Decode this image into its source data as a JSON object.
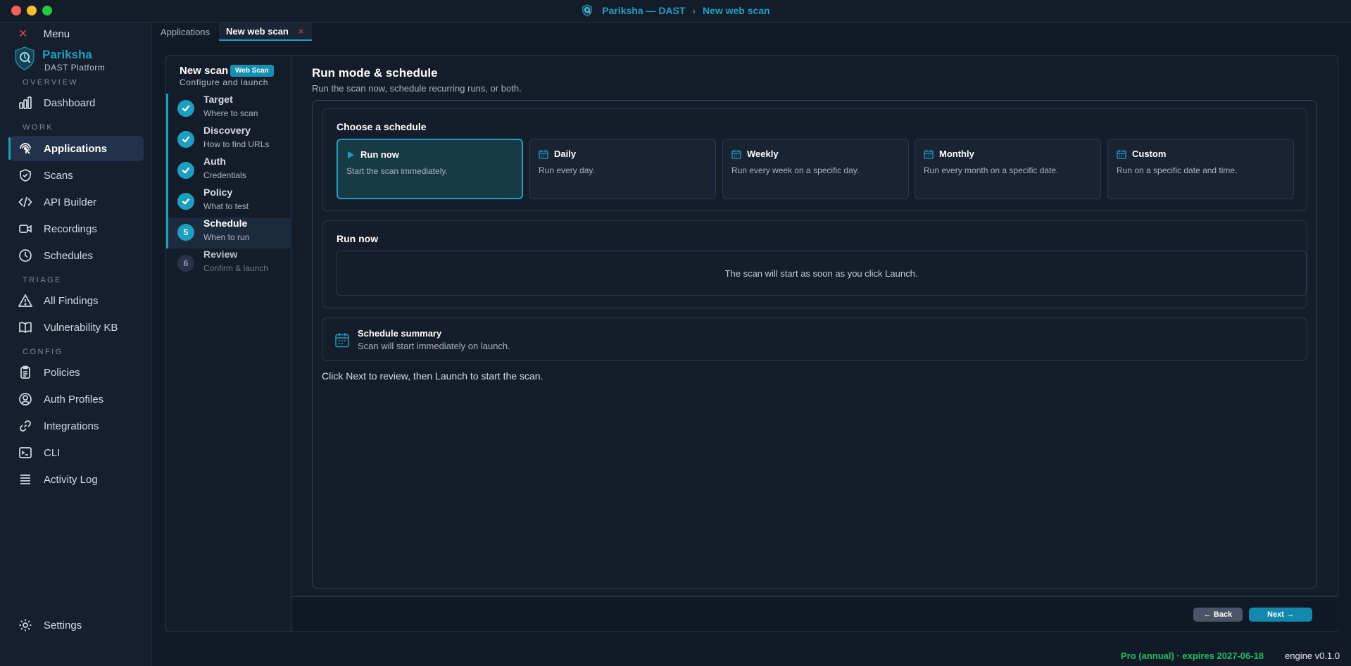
{
  "window": {
    "title_app": "Pariksha — DAST",
    "title_sep": "›",
    "title_page": "New web scan"
  },
  "sidebar": {
    "menu_label": "Menu",
    "brand_name": "Pariksha",
    "brand_sub": "DAST Platform",
    "sections": {
      "overview": "OVERVIEW",
      "work": "WORK",
      "triage": "TRIAGE",
      "config": "CONFIG"
    },
    "items": {
      "dashboard": "Dashboard",
      "applications": "Applications",
      "scans": "Scans",
      "api_builder": "API Builder",
      "recordings": "Recordings",
      "schedules": "Schedules",
      "all_findings": "All Findings",
      "vulnerability_kb": "Vulnerability KB",
      "policies": "Policies",
      "auth_profiles": "Auth Profiles",
      "integrations": "Integrations",
      "cli": "CLI",
      "activity_log": "Activity Log",
      "settings": "Settings"
    },
    "active_item": "Applications"
  },
  "tabs": [
    {
      "label": "Applications"
    },
    {
      "label": "New web scan",
      "close": "×"
    }
  ],
  "wizard": {
    "title": "New scan",
    "badge": "Web Scan",
    "subtitle": "Configure and launch",
    "steps": [
      {
        "title": "Target",
        "subtitle": "Where to scan",
        "state": "done"
      },
      {
        "title": "Discovery",
        "subtitle": "How to find URLs",
        "state": "done"
      },
      {
        "title": "Auth",
        "subtitle": "Credentials",
        "state": "done"
      },
      {
        "title": "Policy",
        "subtitle": "What to test",
        "state": "done"
      },
      {
        "number": "5",
        "title": "Schedule",
        "subtitle": "When to run",
        "state": "active"
      },
      {
        "number": "6",
        "title": "Review",
        "subtitle": "Confirm & launch",
        "state": "pending"
      }
    ]
  },
  "main": {
    "title": "Run mode & schedule",
    "subtitle": "Run the scan now, schedule recurring runs, or both.",
    "choose_title": "Choose a schedule",
    "options": [
      {
        "title": "Run now",
        "desc": "Start the scan immediately.",
        "icon": "play-icon",
        "selected": true
      },
      {
        "title": "Daily",
        "desc": "Run every day.",
        "icon": "calendar-icon",
        "selected": false
      },
      {
        "title": "Weekly",
        "desc": "Run every week on a specific day.",
        "icon": "calendar-icon",
        "selected": false
      },
      {
        "title": "Monthly",
        "desc": "Run every month on a specific date.",
        "icon": "calendar-icon",
        "selected": false
      },
      {
        "title": "Custom",
        "desc": "Run on a specific date and time.",
        "icon": "calendar-icon",
        "selected": false
      }
    ],
    "run_now_title": "Run now",
    "run_now_msg": "The scan will start as soon as you click Launch.",
    "summary_title": "Schedule summary",
    "summary_text": "Scan will start immediately on launch.",
    "hint": "Click Next to review, then Launch to start the scan."
  },
  "footer": {
    "back": "← Back",
    "next": "Next →"
  },
  "status": {
    "license": "Pro (annual) · expires 2027-06-18",
    "engine": "engine v0.1.0"
  },
  "colors": {
    "accent": "#1f9fc0",
    "license_green": "#1fbf5c",
    "close_red": "#e0464e"
  }
}
